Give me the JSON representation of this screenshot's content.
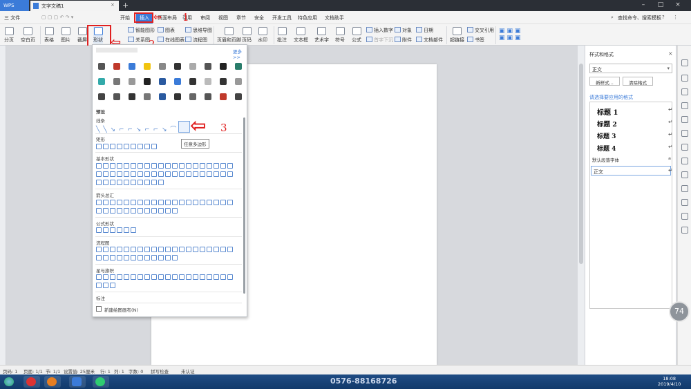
{
  "titlebar": {
    "app": "WPS",
    "tab": "文字文稿1",
    "plus": "+"
  },
  "menu": {
    "file": "三 文件",
    "tabs": [
      "开始",
      "插入",
      "页面布局",
      "引用",
      "审阅",
      "视图",
      "章节",
      "安全",
      "开发工具",
      "特色应用",
      "文档助手"
    ],
    "search": "查找命令、搜索模板"
  },
  "ribbon": {
    "page_break": "分页",
    "blank_page": "空白页",
    "table": "表格",
    "picture": "图片",
    "screenshot": "截屏",
    "shapes": "形状",
    "smart_art": "智能图形",
    "chart": "图表",
    "mind_map": "思维导图",
    "relation": "关系图",
    "online_chart": "在线图表",
    "flowchart": "流程图",
    "header_footer": "页眉和页脚",
    "page_num": "页码",
    "watermark": "水印",
    "comment": "批注",
    "textbox": "文本框",
    "wordart": "艺术字",
    "symbol": "符号",
    "formula": "公式",
    "insert_number": "插入数字",
    "object": "对象",
    "date": "日期",
    "first_letter": "首字下沉",
    "attachment": "附件",
    "doc_parts": "文档部件",
    "hyperlink": "超链接",
    "cross_ref": "交叉引用",
    "bookmark": "书签"
  },
  "annotations": {
    "n1": "1",
    "n2": "2",
    "n3": "3"
  },
  "shapes_panel": {
    "header": "预设",
    "more": "更多 >>",
    "sections": [
      "线条",
      "矩形",
      "基本形状",
      "箭头总汇",
      "公式形状",
      "流程图",
      "星与旗帜",
      "标注"
    ],
    "tooltip": "任意多边形",
    "new_canvas": "新建绘图画布(N)"
  },
  "style_pane": {
    "title": "样式和格式",
    "current": "正文",
    "new_btn": "新样式...",
    "clear_btn": "清除格式",
    "apply_label": "请选择要应用的格式",
    "styles": [
      "标题 1",
      "标题 2",
      "标题 3",
      "标题 4"
    ],
    "default_font": "默认段落字体",
    "normal": "正文",
    "return_mark": "↵",
    "font_mark": "a"
  },
  "zoom": "74",
  "status": {
    "page": "页码: 1",
    "pages": "页面: 1/1",
    "section": "节: 1/1",
    "setting": "设置值: 25厘米",
    "row": "行: 1",
    "col": "列: 1",
    "words": "字数: 0",
    "spell": "拼写检查",
    "cert": "未认证"
  },
  "taskbar": {
    "banner": "0576-88168726",
    "time": "18:08",
    "date": "2019/4/10"
  }
}
